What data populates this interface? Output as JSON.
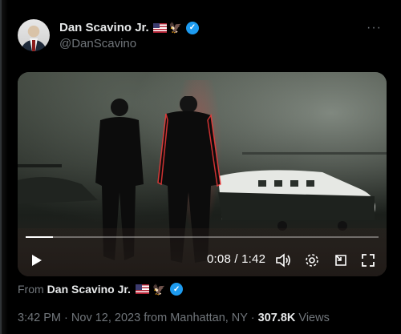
{
  "author": {
    "name": "Dan Scavino Jr.",
    "handle": "@DanScavino",
    "emoji_flag": "us-flag-icon",
    "emoji_eagle": "🦅"
  },
  "more_label": "···",
  "video": {
    "current_time": "0:08",
    "separator": "/",
    "duration": "1:42",
    "progress_fraction": 0.078
  },
  "source": {
    "prefix": "From",
    "name": "Dan Scavino Jr."
  },
  "meta": {
    "time": "3:42 PM",
    "dot1": "·",
    "date": "Nov 12, 2023",
    "location": "from Manhattan, NY",
    "dot2": "·",
    "views_count": "307.8K",
    "views_label": "Views"
  },
  "colors": {
    "accent": "#1d9bf0",
    "background": "#000000",
    "muted_text": "#71767b"
  }
}
